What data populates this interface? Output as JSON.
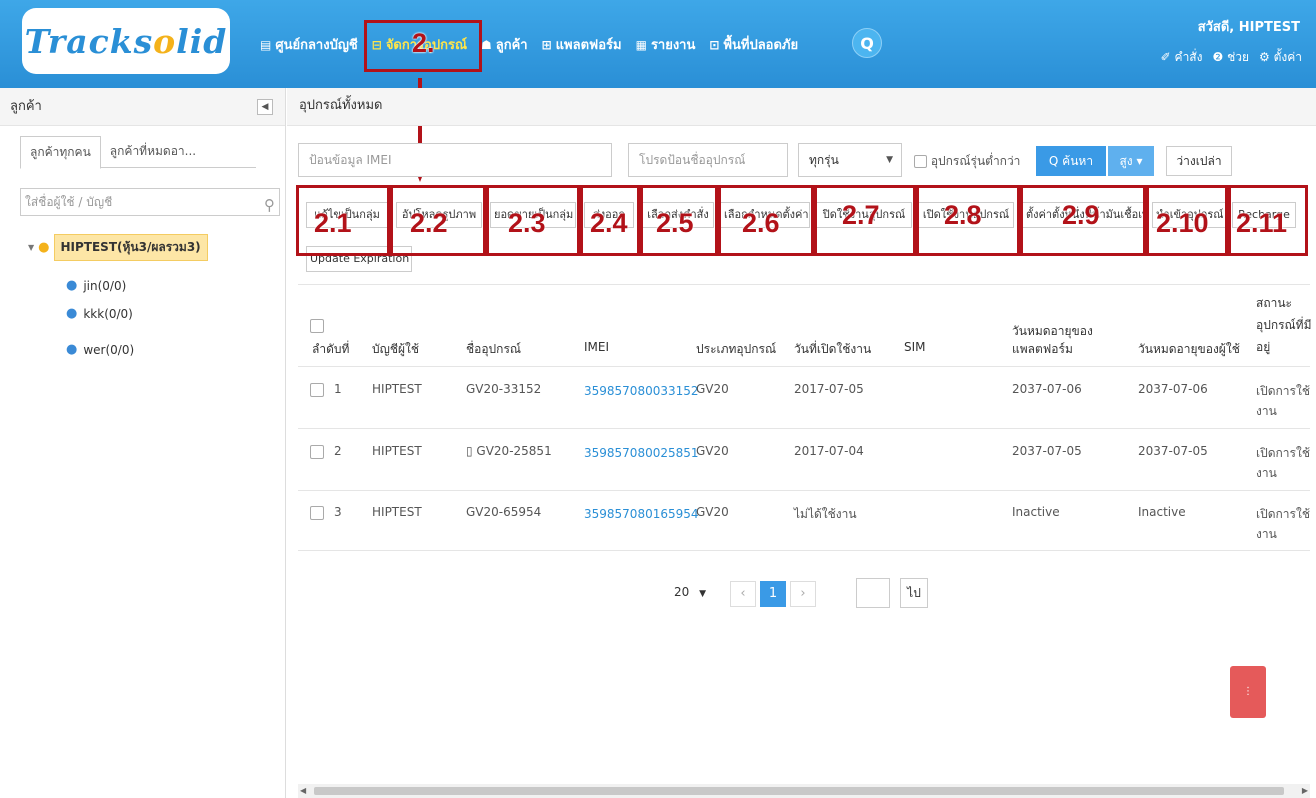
{
  "brand": {
    "logo_text_1": "Track",
    "logo_text_2": "s",
    "logo_text_3": "o",
    "logo_text_4": "lid",
    "primary_color": "#2a8fd6",
    "accent_color": "#b21219"
  },
  "header": {
    "nav": [
      {
        "icon": "dashboard-icon",
        "glyph": "▤",
        "label": "ศูนย์กลางบัญชี"
      },
      {
        "icon": "device-icon",
        "glyph": "⊟",
        "label": "จัดการอุปกรณ์"
      },
      {
        "icon": "customers-icon",
        "glyph": "☗",
        "label": "ลูกค้า"
      },
      {
        "icon": "platform-icon",
        "glyph": "⊞",
        "label": "แพลตฟอร์ม"
      },
      {
        "icon": "report-icon",
        "glyph": "▦",
        "label": "รายงาน"
      },
      {
        "icon": "safe-area-icon",
        "glyph": "⊡",
        "label": "พื้นที่ปลอดภัย"
      }
    ],
    "greeting": "สวัสดี,  HIPTEST",
    "links": {
      "orders": "✐ คำสั่ง",
      "help": "❷ ช่วย",
      "settings": "⚙ ตั้งค่า"
    }
  },
  "sidebar": {
    "title": "ลูกค้า",
    "tabs": [
      "ลูกค้าทุกคน",
      "ลูกค้าที่หมดอา..."
    ],
    "search_placeholder": "ใส่ชื่อผู้ใช้ / บัญชี",
    "root": "HIPTEST(หุ้น3/ผลรวม3)",
    "children": [
      "jin(0/0)",
      "kkk(0/0)",
      "wer(0/0)"
    ]
  },
  "main": {
    "title": "อุปกรณ์ทั้งหมด",
    "filters": {
      "imei_placeholder": "ป้อนข้อมูล IMEI",
      "device_placeholder": "โปรดป้อนชื่ออุปกรณ์",
      "model_select": "ทุกรุ่น",
      "sub_device_label": "อุปกรณ์รุ่นต่ำกว่า",
      "search_label": "Q ค้นหา",
      "more_label": "สูง ▾",
      "clear_label": "ว่างเปล่า"
    },
    "actions": [
      "แก้ไขเป็นกลุ่ม",
      "อัปโหลดรูปภาพ",
      "ยอดขายเป็นกลุ่ม",
      "ส่งออก",
      "เลือกส่งคำสั่ง",
      "เลือกกำหนดตั้งค่า",
      "ปิดใช้งานอุปกรณ์",
      "เปิดใช้งานอุปกรณ์",
      "ตั้งค่าตั้งหนึ่งที่น้ำมันเชื้อเพลิง",
      "นำเข้าอุปกรณ์",
      "Recharge"
    ],
    "update_expiration": "Update Expiration",
    "annotations": [
      "2.",
      "2.1",
      "2.2",
      "2.3",
      "2.4",
      "2.5",
      "2.6",
      "2.7",
      "2.8",
      "2.9",
      "2.10",
      "2.11"
    ],
    "table": {
      "headers": {
        "index": "ลำดับที่",
        "account": "บัญชีผู้ใช้",
        "device_name": "ชื่ออุปกรณ์",
        "imei": "IMEI",
        "type": "ประเภทอุปกรณ์",
        "activated": "วันที่เปิดใช้งาน",
        "sim": "SIM",
        "platform_expiry_1": "วันหมดอายุของ",
        "platform_expiry_2": "แพลตฟอร์ม",
        "user_expiry": "วันหมดอายุของผู้ใช้",
        "status_1": "สถานะ",
        "status_2": "อุปกรณ์ที่มี",
        "status_3": "อยู่"
      },
      "rows": [
        {
          "no": "1",
          "account": "HIPTEST",
          "device": "GV20-33152",
          "imei": "359857080033152",
          "type": "GV20",
          "activated": "2017-07-05",
          "sim": "",
          "platform_exp": "2037-07-06",
          "user_exp": "2037-07-06",
          "status_1": "เปิดการใช้",
          "status_2": "งาน"
        },
        {
          "no": "2",
          "account": "HIPTEST",
          "device": "▯ GV20-25851",
          "imei": "359857080025851",
          "type": "GV20",
          "activated": "2017-07-04",
          "sim": "",
          "platform_exp": "2037-07-05",
          "user_exp": "2037-07-05",
          "status_1": "เปิดการใช้",
          "status_2": "งาน"
        },
        {
          "no": "3",
          "account": "HIPTEST",
          "device": "GV20-65954",
          "imei": "359857080165954",
          "type": "GV20",
          "activated": "ไม่ได้ใช้งาน",
          "sim": "",
          "platform_exp": "Inactive",
          "user_exp": "Inactive",
          "status_1": "เปิดการใช้",
          "status_2": "งาน"
        }
      ]
    },
    "pager": {
      "page_size": "20",
      "prev": "‹",
      "current": "1",
      "next": "›",
      "go_label": "ไป"
    }
  }
}
